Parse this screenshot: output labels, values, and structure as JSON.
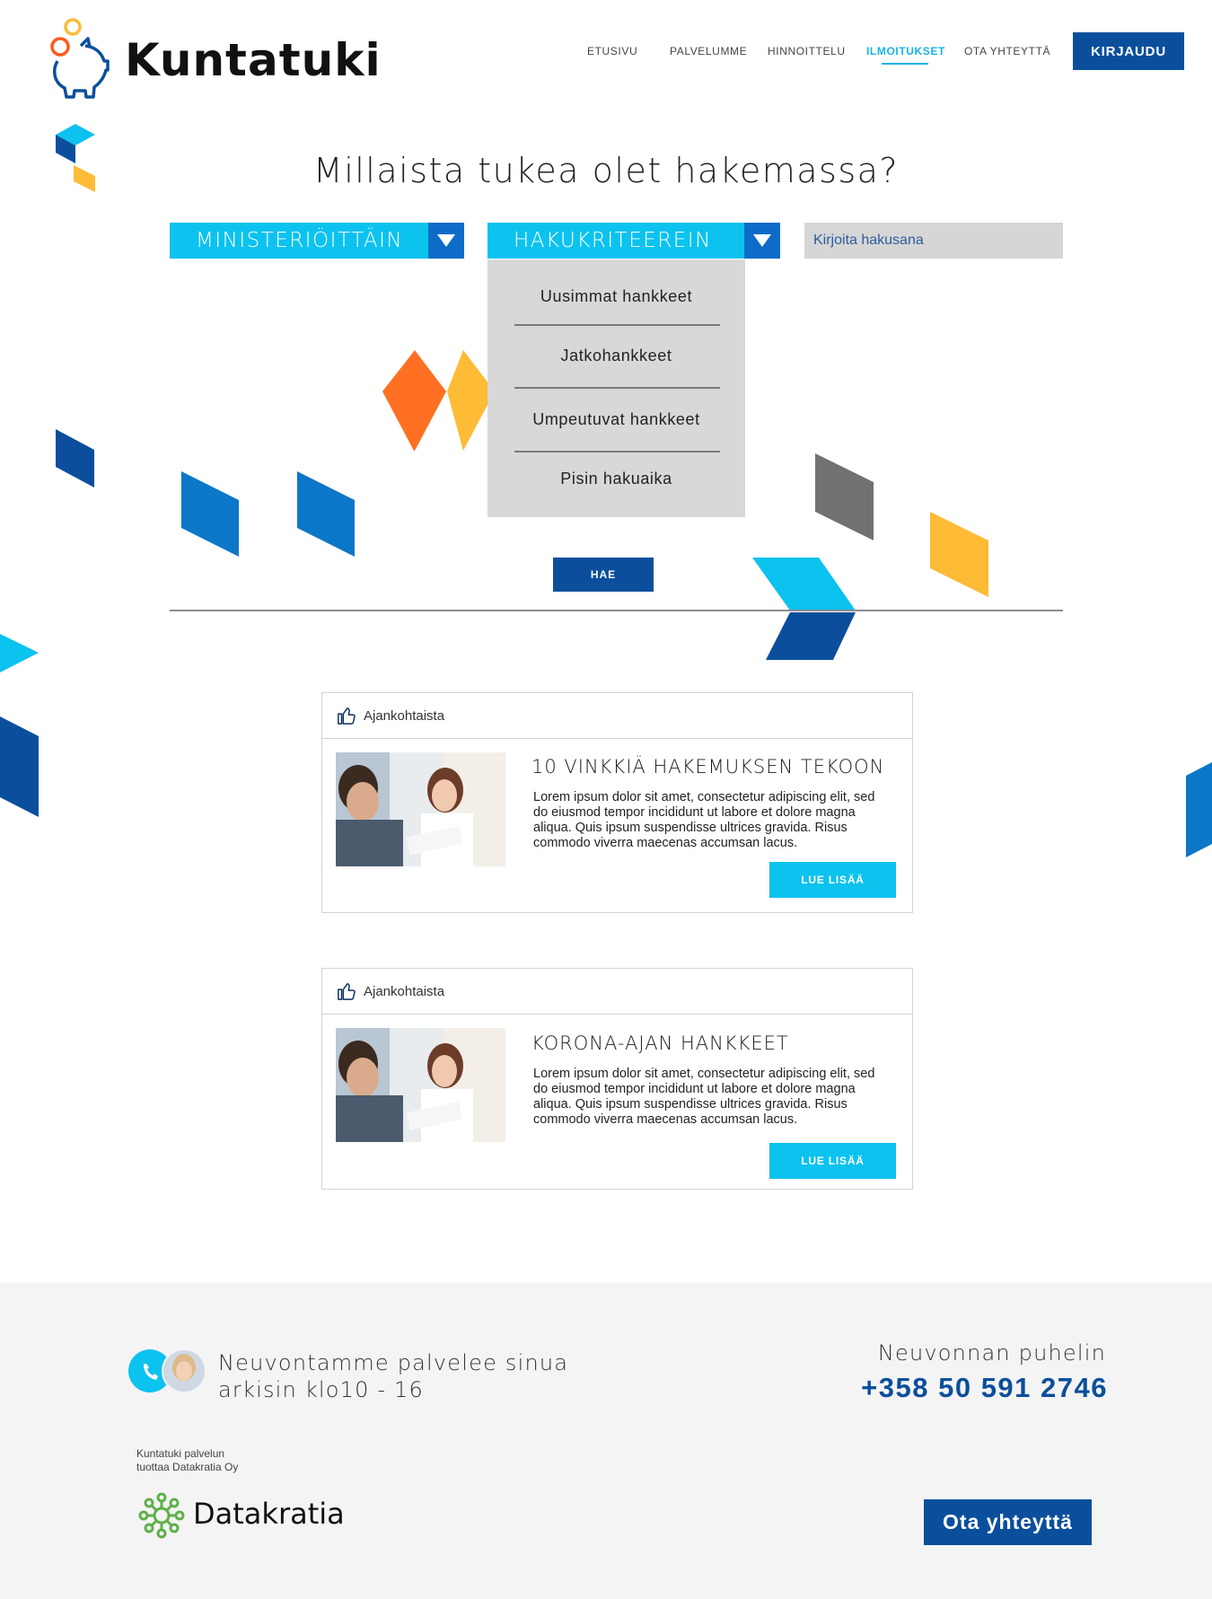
{
  "brand": {
    "name": "Kuntatuki"
  },
  "nav": {
    "items": [
      "ETUSIVU",
      "PALVELUMME",
      "HINNOITTELU",
      "ILMOITUKSET",
      "OTA YHTEYTTÄ"
    ],
    "active": "ILMOITUKSET",
    "login": "KIRJAUDU"
  },
  "hero": {
    "title": "Millaista tukea olet hakemassa?",
    "dropdown_ministry": "MINISTERIÖITTÄIN",
    "dropdown_criteria": "HAKUKRITEEREIN",
    "search_placeholder": "Kirjoita hakusana",
    "menu": [
      "Uusimmat hankkeet",
      "Jatkohankkeet",
      "Umpeutuvat hankkeet",
      "Pisin hakuaika"
    ],
    "search_button": "HAE"
  },
  "cards": [
    {
      "tag": "Ajankohtaista",
      "title": "10 VINKKIÄ HAKEMUKSEN TEKOON",
      "text": "Lorem ipsum dolor sit amet, consectetur adipiscing elit, sed do eiusmod tempor incididunt ut labore et dolore magna aliqua. Quis ipsum suspendisse ultrices gravida. Risus commodo viverra maecenas accumsan lacus.",
      "button": "LUE LISÄÄ"
    },
    {
      "tag": "Ajankohtaista",
      "title": "KORONA-AJAN HANKKEET",
      "text": "Lorem ipsum dolor sit amet, consectetur adipiscing elit, sed do eiusmod tempor incididunt ut labore et dolore magna aliqua. Quis ipsum suspendisse ultrices gravida. Risus commodo viverra maecenas accumsan lacus.",
      "button": "LUE LISÄÄ"
    }
  ],
  "footer": {
    "hours_line1": "Neuvontamme palvelee sinua",
    "hours_line2": "arkisin klo10 - 16",
    "phone_label": "Neuvonnan puhelin",
    "phone": "+358 50 591 2746",
    "producer_line1": "Kuntatuki palvelun",
    "producer_line2": "tuottaa Datakratia Oy",
    "producer_brand": "Datakratia",
    "contact_button": "Ota yhteyttä"
  },
  "colors": {
    "primary_blue": "#0b4f9c",
    "cyan": "#0cc2ef",
    "orange": "#ff7022",
    "yellow": "#fdbb36",
    "grey_shape": "#707173"
  }
}
